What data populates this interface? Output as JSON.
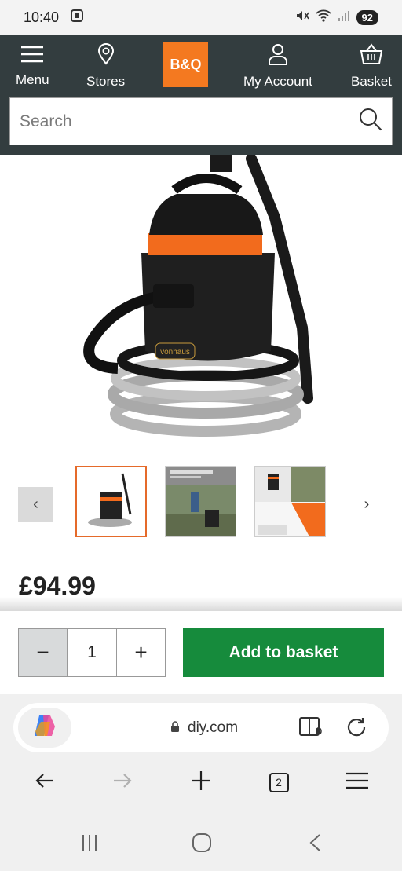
{
  "status": {
    "time": "10:40",
    "battery": "92"
  },
  "header": {
    "menu_label": "Menu",
    "stores_label": "Stores",
    "logo_text": "B&Q",
    "account_label": "My Account",
    "basket_label": "Basket",
    "search_placeholder": "Search"
  },
  "product": {
    "brand_mark": "vonhaus",
    "price": "£94.99",
    "thumbnails": [
      {
        "name": "product-photo"
      },
      {
        "name": "pond-use-photo",
        "caption": "Perfect Pond Maintenance"
      },
      {
        "name": "features-photo"
      }
    ]
  },
  "purchase": {
    "quantity": "1",
    "add_label": "Add to basket"
  },
  "browser": {
    "url": "diy.com",
    "tab_count": "2"
  },
  "colors": {
    "header_bg": "#333d3f",
    "brand_orange": "#f47920",
    "add_button": "#168b3c"
  }
}
